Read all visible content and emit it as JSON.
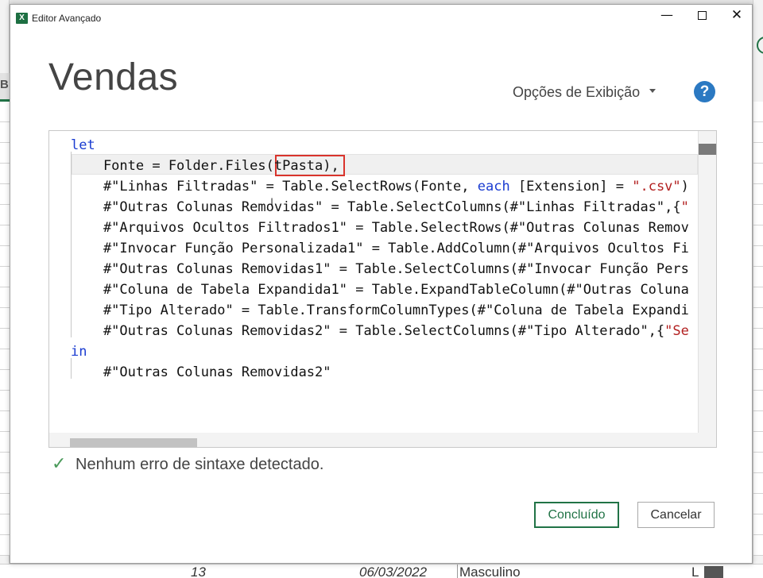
{
  "background": {
    "left_header": "B",
    "row_number": "13",
    "date_cell": "06/03/2022",
    "gender_cell": "Masculino",
    "right_cell": "L"
  },
  "dialog": {
    "window_title": "Editor Avançado",
    "minimize_glyph": "—",
    "close_glyph": "✕",
    "heading": "Vendas",
    "display_options_label": "Opções de Exibição",
    "help_glyph": "?",
    "status_icon": "checkmark-icon",
    "status_text": "Nenhum erro de sintaxe detectado.",
    "done_label": "Concluído",
    "cancel_label": "Cancelar"
  },
  "editor": {
    "lines": [
      {
        "segments": [
          {
            "t": "let",
            "c": "kw"
          }
        ]
      },
      {
        "segments": [
          {
            "t": "    Fonte = Folder.Files(tPasta),",
            "c": ""
          }
        ]
      },
      {
        "segments": [
          {
            "t": "    #\"Linhas Filtradas\" = Table.SelectRows(Fonte, ",
            "c": ""
          },
          {
            "t": "each",
            "c": "kw"
          },
          {
            "t": " [Extension] = ",
            "c": ""
          },
          {
            "t": "\".csv\"",
            "c": "str"
          },
          {
            "t": ")",
            "c": ""
          }
        ]
      },
      {
        "segments": [
          {
            "t": "    #\"Outras Colunas Removidas\" = Table.SelectColumns(#\"Linhas Filtradas\",{",
            "c": ""
          },
          {
            "t": "\"",
            "c": "str"
          }
        ]
      },
      {
        "segments": [
          {
            "t": "    #\"Arquivos Ocultos Filtrados1\" = Table.SelectRows(#\"Outras Colunas Remov",
            "c": ""
          }
        ]
      },
      {
        "segments": [
          {
            "t": "    #\"Invocar Função Personalizada1\" = Table.AddColumn(#\"Arquivos Ocultos Fi",
            "c": ""
          }
        ]
      },
      {
        "segments": [
          {
            "t": "    #\"Outras Colunas Removidas1\" = Table.SelectColumns(#\"Invocar Função Pers",
            "c": ""
          }
        ]
      },
      {
        "segments": [
          {
            "t": "    #\"Coluna de Tabela Expandida1\" = Table.ExpandTableColumn(#\"Outras Coluna",
            "c": ""
          }
        ]
      },
      {
        "segments": [
          {
            "t": "    #\"Tipo Alterado\" = Table.TransformColumnTypes(#\"Coluna de Tabela Expandi",
            "c": ""
          }
        ]
      },
      {
        "segments": [
          {
            "t": "    #\"Outras Colunas Removidas2\" = Table.SelectColumns(#\"Tipo Alterado\",{",
            "c": ""
          },
          {
            "t": "\"Se",
            "c": "str"
          }
        ]
      },
      {
        "segments": [
          {
            "t": "in",
            "c": "kw"
          }
        ]
      },
      {
        "segments": [
          {
            "t": "    #\"Outras Colunas Removidas2\"",
            "c": ""
          }
        ]
      }
    ]
  }
}
